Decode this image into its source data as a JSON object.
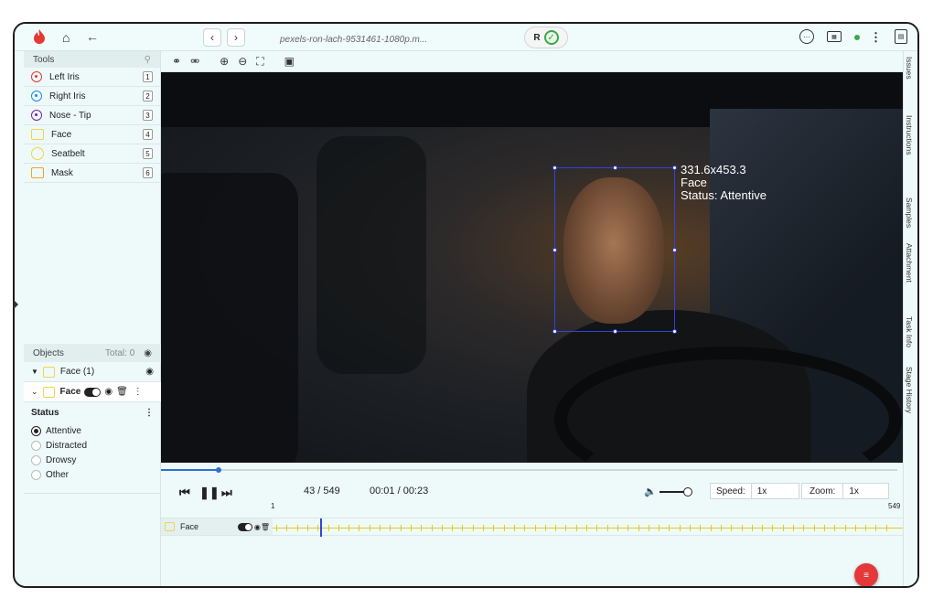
{
  "topbar": {
    "filename": "pexels-ron-lach-9531461-1080p.m...",
    "sync_label": "R"
  },
  "tools": {
    "header": "Tools",
    "items": [
      {
        "label": "Left Iris",
        "key": "1",
        "color": "#e53935",
        "shape": "point"
      },
      {
        "label": "Right Iris",
        "key": "2",
        "color": "#1e88e5",
        "shape": "point"
      },
      {
        "label": "Nose - Tip",
        "key": "3",
        "color": "#7b1fa2",
        "shape": "point"
      },
      {
        "label": "Face",
        "key": "4",
        "color": "#f3d34a",
        "shape": "box"
      },
      {
        "label": "Seatbelt",
        "key": "5",
        "color": "#f3d34a",
        "shape": "circle"
      },
      {
        "label": "Mask",
        "key": "6",
        "color": "#f0a030",
        "shape": "box"
      }
    ]
  },
  "objects": {
    "header": "Objects",
    "total": "Total: 0",
    "group_label": "Face (1)",
    "item_label": "Face",
    "attribute_title": "Status",
    "options": [
      "Attentive",
      "Distracted",
      "Drowsy",
      "Other"
    ],
    "selected": "Attentive"
  },
  "annotation": {
    "size": "331.6x453.3",
    "label": "Face",
    "status": "Status: Attentive"
  },
  "timeline": {
    "frame": "43 / 549",
    "time": "00:01 / 00:23",
    "speed_label": "Speed:",
    "speed_value": "1x",
    "zoom_label": "Zoom:",
    "zoom_value": "1x",
    "start_frame": "1",
    "end_frame": "549",
    "track_label": "Face",
    "progress": 0.078
  },
  "rail": [
    "Issues",
    "Instructions",
    "Samples",
    "Attachment",
    "Task Info",
    "Stage History"
  ]
}
